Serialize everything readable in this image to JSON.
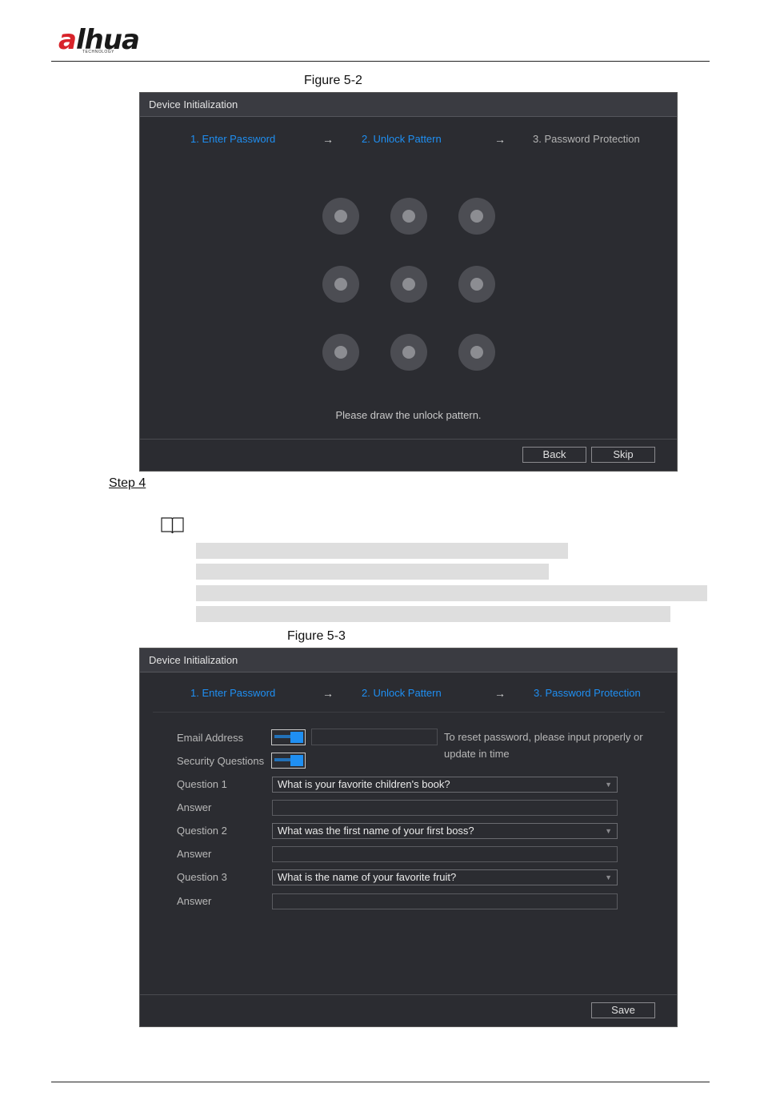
{
  "header": {
    "logo_text": "alhua",
    "logo_sub": "TECHNOLOGY"
  },
  "figure1": {
    "caption": "Figure 5-2",
    "title": "Device Initialization",
    "steps": [
      "1.  Enter Password",
      "2.  Unlock Pattern",
      "3.  Password Protection"
    ],
    "arrow": "→",
    "hint": "Please draw the unlock pattern.",
    "back_label": "Back",
    "skip_label": "Skip"
  },
  "step4": {
    "label": "Step 4"
  },
  "figure2": {
    "caption": "Figure 5-3",
    "title": "Device Initialization",
    "steps": [
      "1.  Enter Password",
      "2.  Unlock Pattern",
      "3.  Password Protection"
    ],
    "arrow": "→",
    "email_label": "Email Address",
    "security_label": "Security Questions",
    "note": "To reset password, please input properly or update in time",
    "q1_label": "Question 1",
    "q1_value": "What is your favorite children's book?",
    "a1_label": "Answer",
    "q2_label": "Question 2",
    "q2_value": "What was the first name of your first boss?",
    "a2_label": "Answer",
    "q3_label": "Question 3",
    "q3_value": "What is the name of your favorite fruit?",
    "a3_label": "Answer",
    "save_label": "Save"
  },
  "colors": {
    "accent": "#1f8ff2",
    "panel": "#2b2c31",
    "brand_red": "#d8232a"
  }
}
